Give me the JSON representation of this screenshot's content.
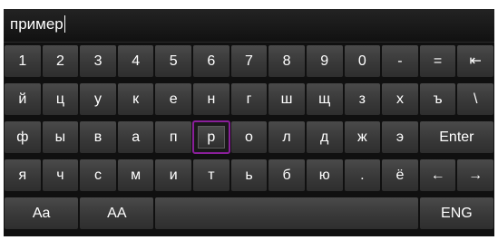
{
  "input": {
    "value": "пример"
  },
  "rows": [
    [
      "1",
      "2",
      "3",
      "4",
      "5",
      "6",
      "7",
      "8",
      "9",
      "0",
      "-",
      "=",
      "⇤"
    ],
    [
      "й",
      "ц",
      "у",
      "к",
      "е",
      "н",
      "г",
      "ш",
      "щ",
      "з",
      "х",
      "ъ",
      "\\"
    ],
    [
      "ф",
      "ы",
      "в",
      "а",
      "п",
      "р",
      "о",
      "л",
      "д",
      "ж",
      "э",
      "Enter"
    ],
    [
      "я",
      "ч",
      "с",
      "м",
      "и",
      "т",
      "ь",
      "б",
      "ю",
      ".",
      "ё",
      "←",
      "→"
    ],
    [
      "Aa",
      "AA",
      "",
      "ENG"
    ]
  ],
  "selected_key": "р",
  "colors": {
    "selection_border": "#8a1f9a",
    "key_face": "#3a3a3a",
    "background": "#101010"
  },
  "icons": {
    "backspace": "tab-back-icon",
    "left": "arrow-left-icon",
    "right": "arrow-right-icon"
  }
}
